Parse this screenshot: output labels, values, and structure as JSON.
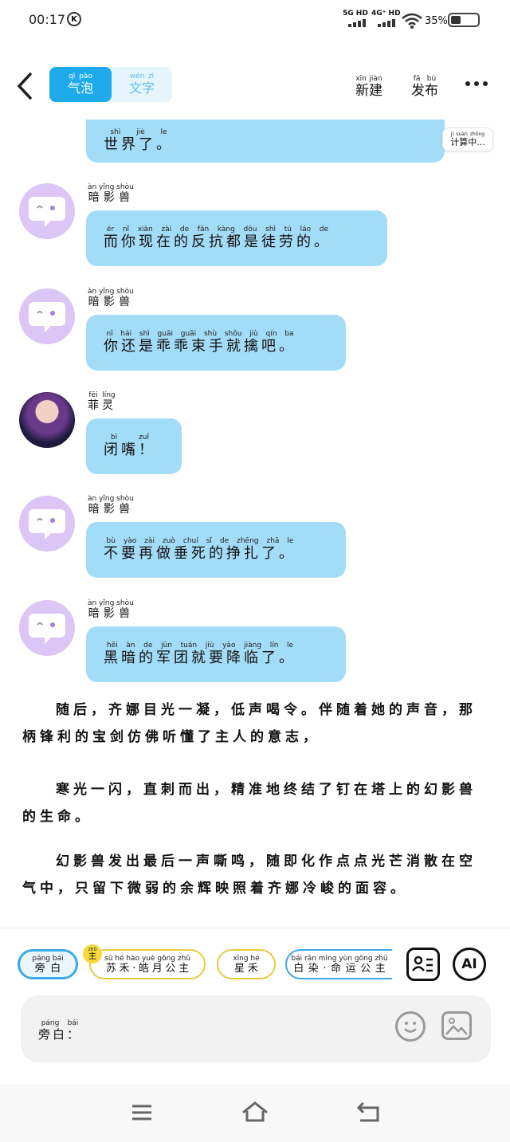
{
  "status_bar": {
    "time": "00:17",
    "k_badge": "K",
    "net1": "5G HD",
    "net2": "4G⁺ HD",
    "battery": "35%"
  },
  "header": {
    "tab_bubble": "气泡",
    "tab_bubble_py": "qì pào",
    "tab_text": "文字",
    "tab_text_py": "wén zì",
    "new_label": "新建",
    "new_py": "xīn jiàn",
    "publish_label": "发布",
    "publish_py": "fā bù"
  },
  "chat": {
    "partial_text": "世界了。",
    "partial_py": "shì jiè le",
    "calc_label": "计算中...",
    "calc_py": "jì suàn zhōng",
    "messages": [
      {
        "speaker": "暗影兽",
        "speaker_py": "àn yǐng shòu",
        "text": "而你现在的反抗都是徒劳的。",
        "py": "ér nǐ xiàn zài de fǎn kàng dōu shì tú láo de"
      },
      {
        "speaker": "暗影兽",
        "speaker_py": "àn yǐng shòu",
        "text": "你还是乖乖束手就擒吧。",
        "py": "nǐ hái shì guāi guāi shù shǒu jiù qín ba"
      },
      {
        "speaker": "菲灵",
        "speaker_py": "fēi líng",
        "text": "闭嘴！",
        "py": "bì zuǐ"
      },
      {
        "speaker": "暗影兽",
        "speaker_py": "àn yǐng shòu",
        "text": "不要再做垂死的挣扎了。",
        "py": "bù yào zài zuò chuí sǐ de zhēng zhā le"
      },
      {
        "speaker": "暗影兽",
        "speaker_py": "àn yǐng shòu",
        "text": "黑暗的军团就要降临了。",
        "py": "hēi àn de jūn tuán jiù yào jiàng lín le"
      }
    ]
  },
  "narration": [
    {
      "text": "随后，齐娜目光一凝，低声喝令。伴随着她的声音，那柄锋利的宝剑仿佛听懂了主人的意志，"
    },
    {
      "text": "寒光一闪，直刺而出，精准地终结了钉在塔上的幻影兽的生命。"
    },
    {
      "text": "幻影兽发出最后一声嘶鸣，随即化作点点光芒消散在空气中，只留下微弱的余辉映照着齐娜冷峻的面容。"
    }
  ],
  "roles": {
    "narrator": "旁白",
    "narrator_py": "páng bái",
    "host_badge": "主",
    "host_py": "zhǔ",
    "role1": "苏禾·皓月公主",
    "role1_py": "sū hé hào yuè gōng zhǔ",
    "role2": "星禾",
    "role2_py": "xīng hé",
    "role3": "白染·命运公主",
    "role3_py": "bái rǎn mìng yùn gōng zhǔ",
    "ai_label": "AI"
  },
  "input": {
    "prefix": "旁白：",
    "prefix_py": "páng bái"
  }
}
